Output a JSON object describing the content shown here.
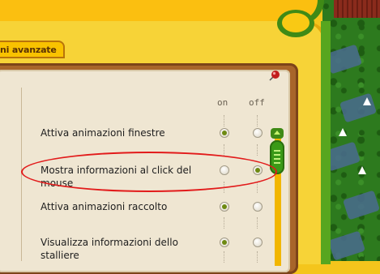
{
  "tab": {
    "label": "ni avanzate"
  },
  "columns": {
    "on": "on",
    "off": "off"
  },
  "settings": [
    {
      "label": "Attiva animazioni finestre",
      "value": "on"
    },
    {
      "label": "Mostra informazioni al click del mouse",
      "value": "off"
    },
    {
      "label": "Attiva animazioni raccolto",
      "value": "on"
    },
    {
      "label": "Visualizza informazioni dello stalliere",
      "value": "on"
    }
  ],
  "colors": {
    "frame_green": "#3f8a16",
    "panel_yellow": "#f7d337",
    "paper": "#efe6d2",
    "highlight": "#e21b1b",
    "selected_radio": "#6e8a12"
  },
  "icons": {
    "pin": "pushpin-icon",
    "scroll_up": "chevron-up-icon"
  }
}
